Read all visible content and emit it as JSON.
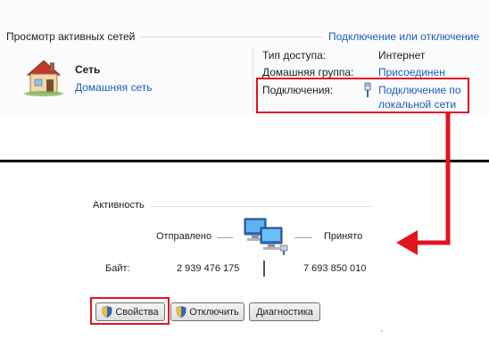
{
  "network_center": {
    "section_title": "Просмотр активных сетей",
    "connect_link": "Подключение или отключение",
    "network": {
      "icon": "house-icon",
      "name": "Сеть",
      "type_link": "Домашняя сеть"
    },
    "properties": {
      "access_label": "Тип доступа:",
      "access_value": "Интернет",
      "homegroup_label": "Домашняя группа:",
      "homegroup_value": "Присоединен",
      "connections_label": "Подключения:",
      "connections_value_line1": "Подключение по",
      "connections_value_line2": "локальной сети",
      "connections_icon": "ethernet-plug-icon"
    }
  },
  "status_dialog": {
    "activity_label": "Активность",
    "sent_label": "Отправлено",
    "received_label": "Принято",
    "bytes_label": "Байт:",
    "bytes_sent": "2 939 476 175",
    "bytes_received": "7 693 850 010",
    "buttons": {
      "properties": "Свойства",
      "disable": "Отключить",
      "diagnostics": "Диагностика"
    }
  },
  "colors": {
    "link": "#1c5eb4",
    "highlight_red": "#e1141f",
    "divider": "#000000"
  }
}
